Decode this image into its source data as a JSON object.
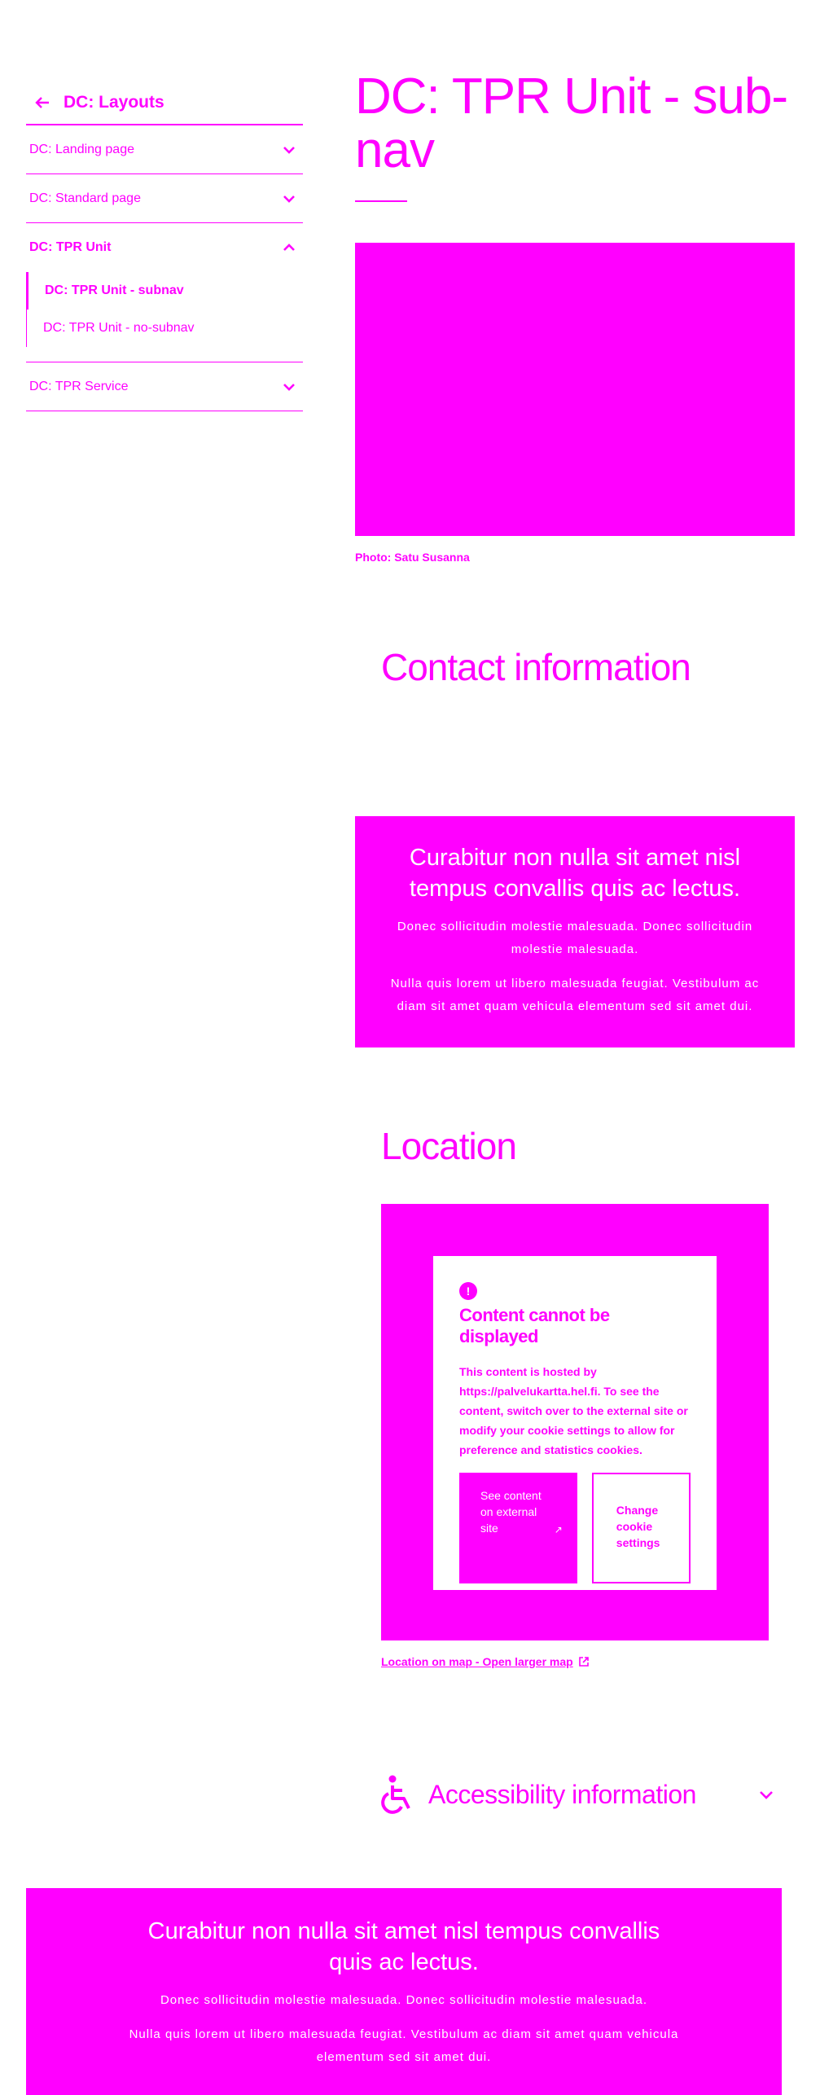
{
  "sidebar": {
    "back_label": "DC: Layouts",
    "items": [
      {
        "label": "DC: Landing page"
      },
      {
        "label": "DC: Standard page"
      },
      {
        "label": "DC: TPR Unit"
      },
      {
        "label": "DC: TPR Service"
      }
    ],
    "subitems": [
      {
        "label": "DC: TPR Unit - subnav"
      },
      {
        "label": "DC: TPR Unit - no-subnav"
      }
    ]
  },
  "main": {
    "title": "DC: TPR Unit - sub-nav",
    "photo_caption": "Photo: Satu Susanna",
    "contact_heading": "Contact information",
    "info_box": {
      "lead": "Curabitur non nulla sit amet nisl tempus convallis quis ac lectus.",
      "p1": "Donec sollicitudin molestie malesuada. Donec sollicitudin molestie malesuada.",
      "p2": "Nulla quis lorem ut libero malesuada feugiat. Vestibulum ac diam sit amet quam vehicula elementum sed sit amet dui."
    },
    "location_heading": "Location",
    "consent": {
      "title": "Content cannot be displayed",
      "body": "This content is hosted by https://palvelukartta.hel.fi. To see the content, switch over to the external site or modify your cookie settings to allow for preference and statistics cookies.",
      "ext_button": "See content on external site",
      "cookie_button": "Change cookie settings"
    },
    "map_link": "Location on map - Open larger map",
    "accessibility_heading": "Accessibility information"
  },
  "footer_box": {
    "lead": "Curabitur non nulla sit amet nisl tempus convallis quis ac lectus.",
    "p1": "Donec sollicitudin molestie malesuada. Donec sollicitudin molestie malesuada.",
    "p2": "Nulla quis lorem ut libero malesuada feugiat. Vestibulum ac diam sit amet quam vehicula elementum sed sit amet dui."
  },
  "colors": {
    "accent": "#ff00ff",
    "background": "#ffffff"
  },
  "icons": [
    "arrow-left-icon",
    "chevron-down-icon",
    "chevron-up-icon",
    "alert-icon",
    "external-link-icon",
    "wheelchair-icon"
  ]
}
